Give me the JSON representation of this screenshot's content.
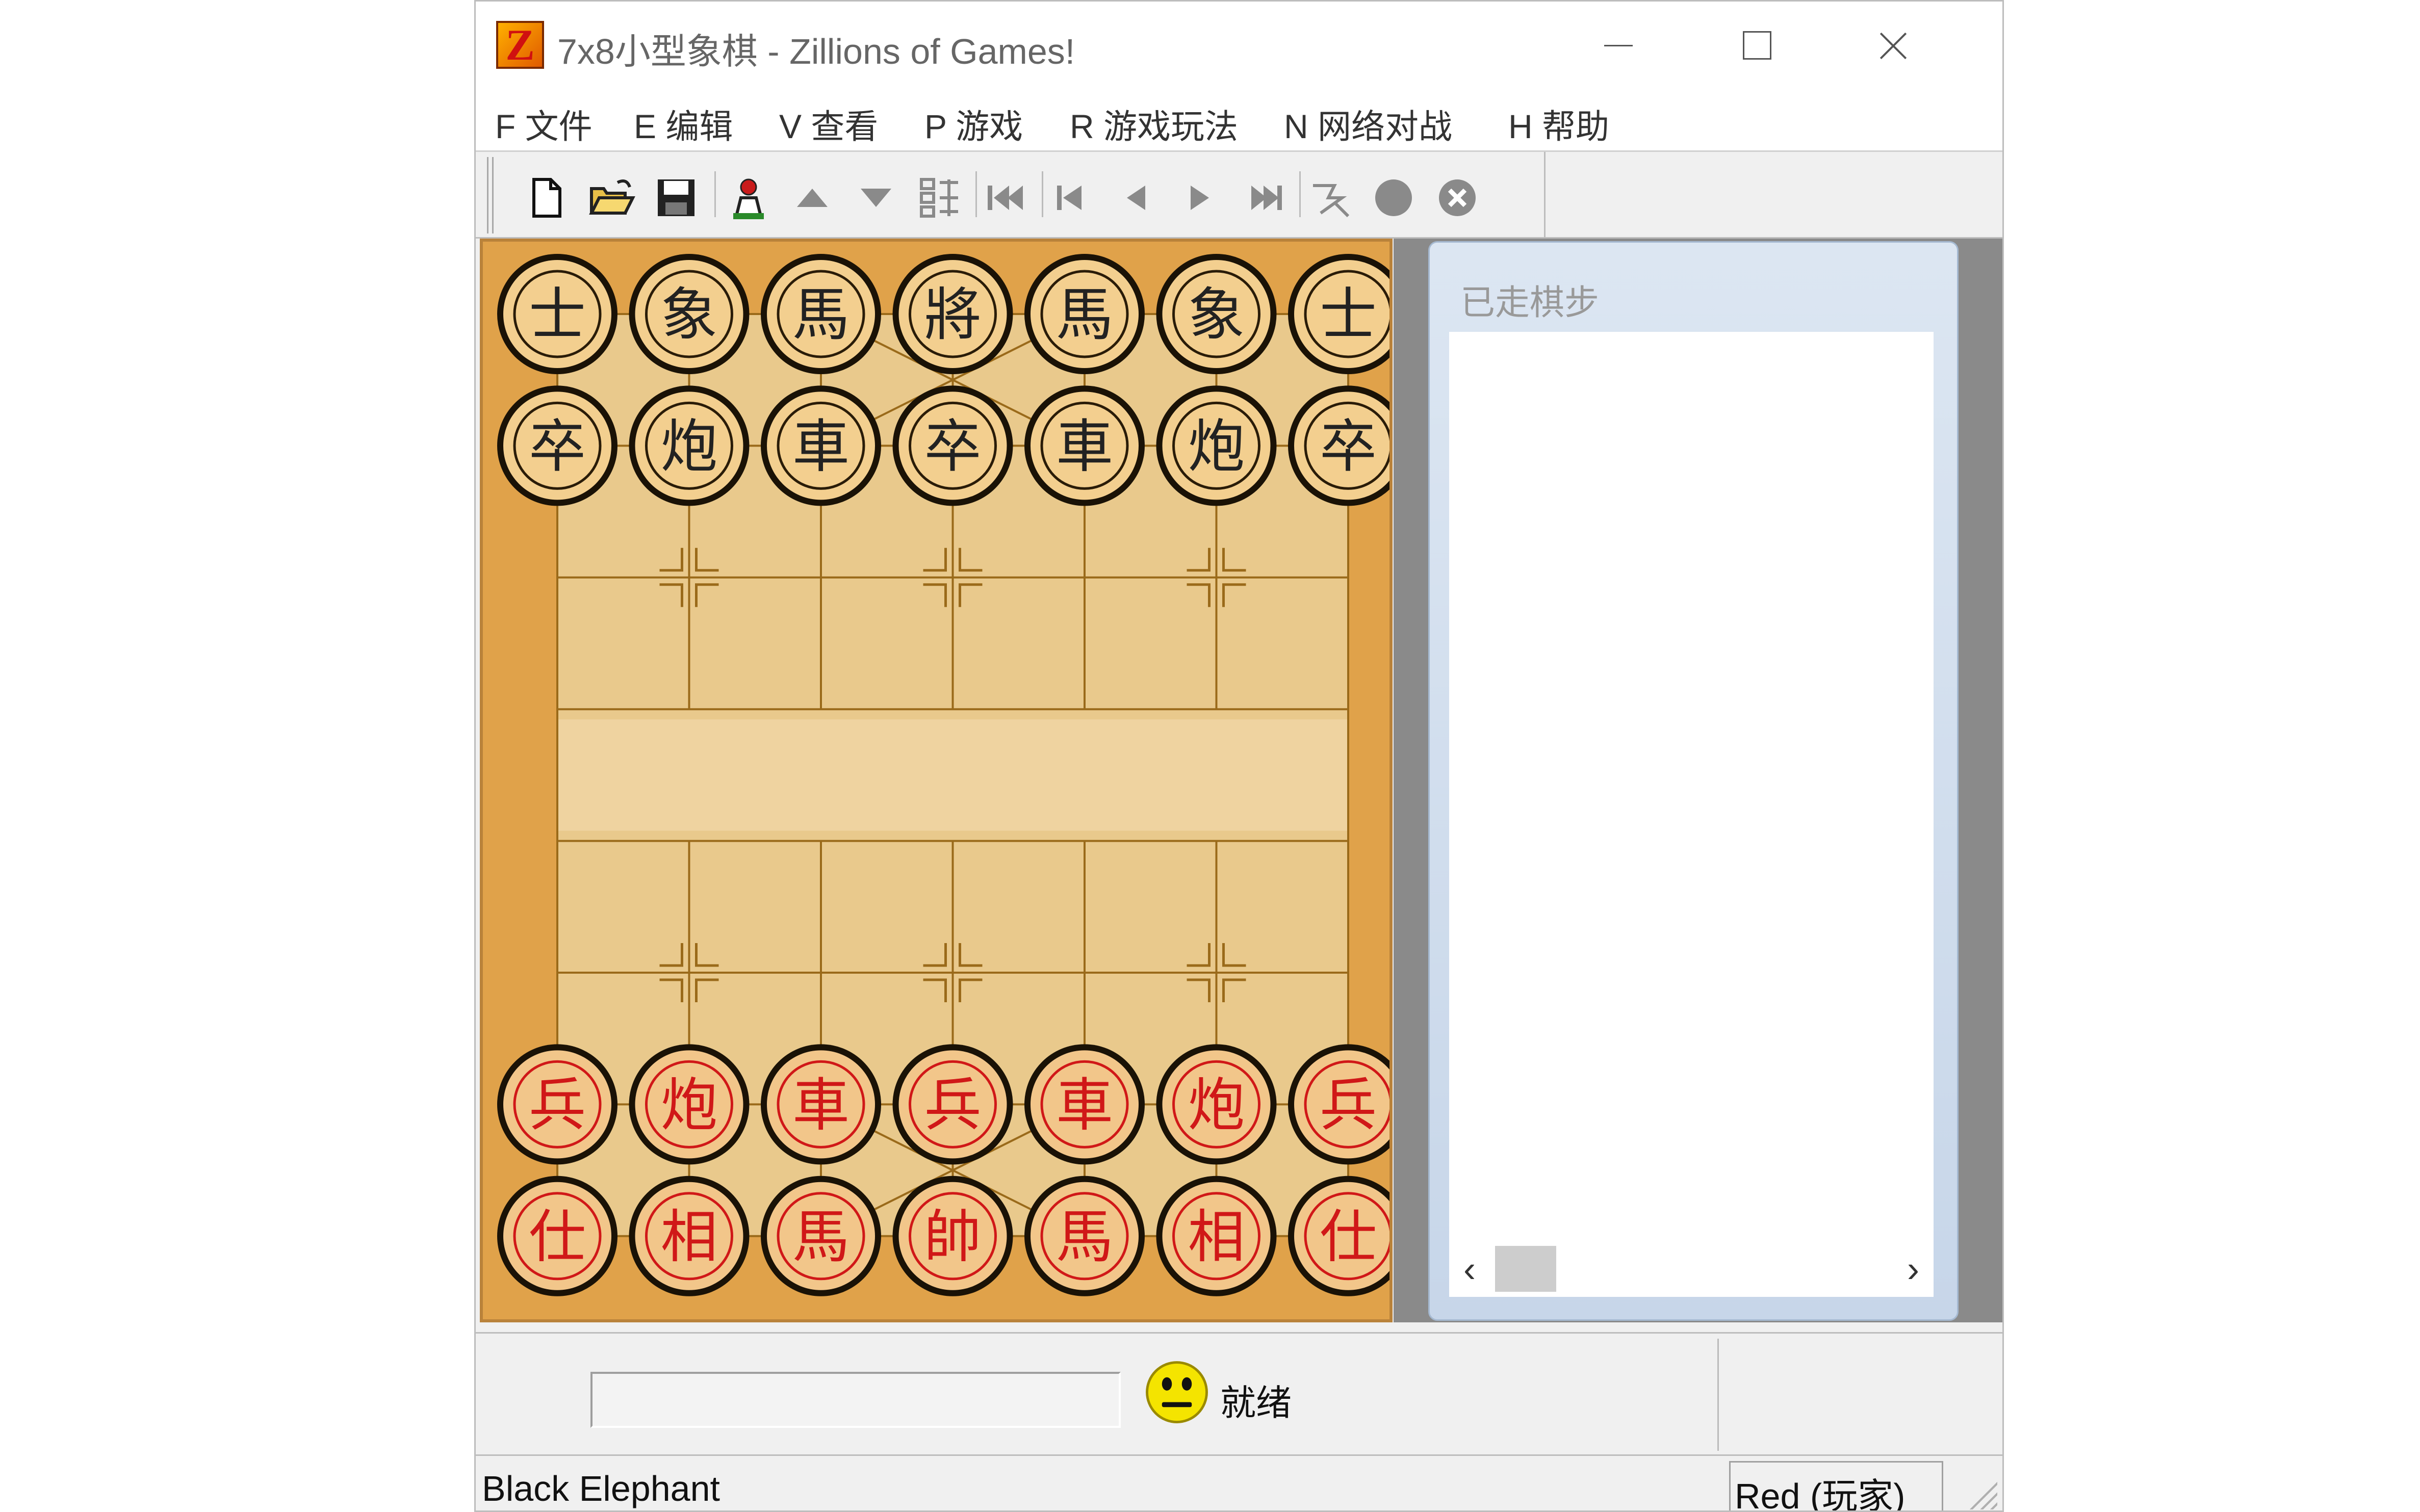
{
  "window": {
    "title": "7x8小型象棋 - Zillions of Games!",
    "logo_letter": "Z"
  },
  "menu": [
    {
      "key": "file",
      "label": "F 文件"
    },
    {
      "key": "edit",
      "label": "E 编辑"
    },
    {
      "key": "view",
      "label": "V 查看"
    },
    {
      "key": "game",
      "label": "P 游戏"
    },
    {
      "key": "rules",
      "label": "R 游戏玩法"
    },
    {
      "key": "network",
      "label": "N 网络对战"
    },
    {
      "key": "help",
      "label": "H 帮助"
    }
  ],
  "toolbar": [
    {
      "name": "new-file-icon"
    },
    {
      "name": "open-folder-icon"
    },
    {
      "name": "save-icon"
    },
    {
      "name": "player-icon"
    },
    {
      "name": "move-up-icon"
    },
    {
      "name": "move-down-icon"
    },
    {
      "name": "piece-list-icon"
    },
    {
      "name": "first-move-icon"
    },
    {
      "name": "step-back-icon"
    },
    {
      "name": "back-icon"
    },
    {
      "name": "forward-icon"
    },
    {
      "name": "step-forward-icon"
    },
    {
      "name": "hint-icon"
    },
    {
      "name": "record-icon"
    },
    {
      "name": "stop-icon"
    }
  ],
  "board": {
    "columns": 7,
    "rows": 8,
    "colors": {
      "frame": "#e0a24a",
      "cells": "#e9c98c",
      "lines": "#9a6a1a",
      "black_text": "#222222",
      "red_text": "#d01818"
    },
    "pieces": [
      {
        "row": 0,
        "col": 0,
        "side": "black",
        "char": "士"
      },
      {
        "row": 0,
        "col": 1,
        "side": "black",
        "char": "象"
      },
      {
        "row": 0,
        "col": 2,
        "side": "black",
        "char": "馬"
      },
      {
        "row": 0,
        "col": 3,
        "side": "black",
        "char": "將"
      },
      {
        "row": 0,
        "col": 4,
        "side": "black",
        "char": "馬"
      },
      {
        "row": 0,
        "col": 5,
        "side": "black",
        "char": "象"
      },
      {
        "row": 0,
        "col": 6,
        "side": "black",
        "char": "士"
      },
      {
        "row": 1,
        "col": 0,
        "side": "black",
        "char": "卒"
      },
      {
        "row": 1,
        "col": 1,
        "side": "black",
        "char": "炮"
      },
      {
        "row": 1,
        "col": 2,
        "side": "black",
        "char": "車"
      },
      {
        "row": 1,
        "col": 3,
        "side": "black",
        "char": "卒"
      },
      {
        "row": 1,
        "col": 4,
        "side": "black",
        "char": "車"
      },
      {
        "row": 1,
        "col": 5,
        "side": "black",
        "char": "炮"
      },
      {
        "row": 1,
        "col": 6,
        "side": "black",
        "char": "卒"
      },
      {
        "row": 6,
        "col": 0,
        "side": "red",
        "char": "兵"
      },
      {
        "row": 6,
        "col": 1,
        "side": "red",
        "char": "炮"
      },
      {
        "row": 6,
        "col": 2,
        "side": "red",
        "char": "車"
      },
      {
        "row": 6,
        "col": 3,
        "side": "red",
        "char": "兵"
      },
      {
        "row": 6,
        "col": 4,
        "side": "red",
        "char": "車"
      },
      {
        "row": 6,
        "col": 5,
        "side": "red",
        "char": "炮"
      },
      {
        "row": 6,
        "col": 6,
        "side": "red",
        "char": "兵"
      },
      {
        "row": 7,
        "col": 0,
        "side": "red",
        "char": "仕"
      },
      {
        "row": 7,
        "col": 1,
        "side": "red",
        "char": "相"
      },
      {
        "row": 7,
        "col": 2,
        "side": "red",
        "char": "馬"
      },
      {
        "row": 7,
        "col": 3,
        "side": "red",
        "char": "帥"
      },
      {
        "row": 7,
        "col": 4,
        "side": "red",
        "char": "馬"
      },
      {
        "row": 7,
        "col": 5,
        "side": "red",
        "char": "相"
      },
      {
        "row": 7,
        "col": 6,
        "side": "red",
        "char": "仕"
      }
    ]
  },
  "moves_panel": {
    "title": "已走棋步",
    "scroll_left": "‹",
    "scroll_right": "›"
  },
  "status": {
    "message": "就绪",
    "piece_name": "Black Elephant",
    "player": "Red (玩家)"
  }
}
